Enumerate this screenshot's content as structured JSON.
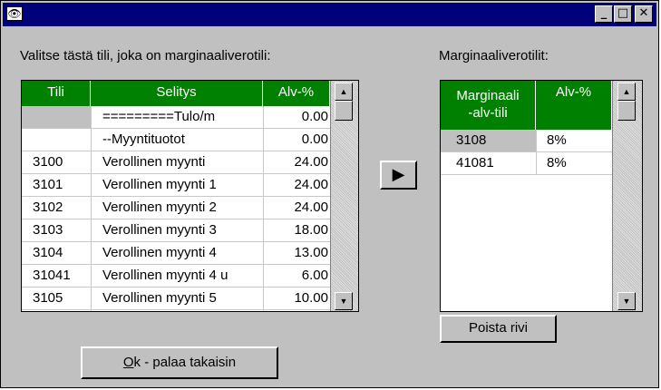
{
  "window": {
    "icon": "eye-icon",
    "minimize_label": "_",
    "maximize_label": "□",
    "close_label": "✕"
  },
  "left": {
    "title": "Valitse tästä tili, joka on  marginaaliverotili:",
    "columns": [
      "Tili",
      "Selitys",
      "Alv-%"
    ],
    "rows": [
      {
        "tili": "",
        "selitys": "=========Tulo/m",
        "alv": "0.00"
      },
      {
        "tili": "",
        "selitys": "--Myyntituotot",
        "alv": "0.00"
      },
      {
        "tili": "3100",
        "selitys": "Verollinen myynti",
        "alv": "24.00"
      },
      {
        "tili": "3101",
        "selitys": "Verollinen myynti 1",
        "alv": "24.00"
      },
      {
        "tili": "3102",
        "selitys": "Verollinen myynti 2",
        "alv": "24.00"
      },
      {
        "tili": "3103",
        "selitys": "Verollinen myynti 3",
        "alv": "18.00"
      },
      {
        "tili": "3104",
        "selitys": "Verollinen myynti 4",
        "alv": "13.00"
      },
      {
        "tili": "31041",
        "selitys": "Verollinen myynti 4 u",
        "alv": "6.00"
      },
      {
        "tili": "3105",
        "selitys": "Verollinen myynti 5",
        "alv": "10.00"
      }
    ]
  },
  "transfer_button": "▶",
  "right": {
    "title": "Marginaaliverotilit:",
    "columns": [
      "Marginaali\n-alv-tili",
      "Alv-%"
    ],
    "rows": [
      {
        "tili": "3108",
        "alv": "8%"
      },
      {
        "tili": "41081",
        "alv": "8%"
      }
    ]
  },
  "buttons": {
    "delete_row": "Poista rivi",
    "ok_accesskey": "O",
    "ok_rest": "k - palaa takaisin"
  },
  "scroll_up_glyph": "▲",
  "scroll_down_glyph": "▼",
  "colors": {
    "header_green": "#008000",
    "titlebar": "#00007b"
  }
}
